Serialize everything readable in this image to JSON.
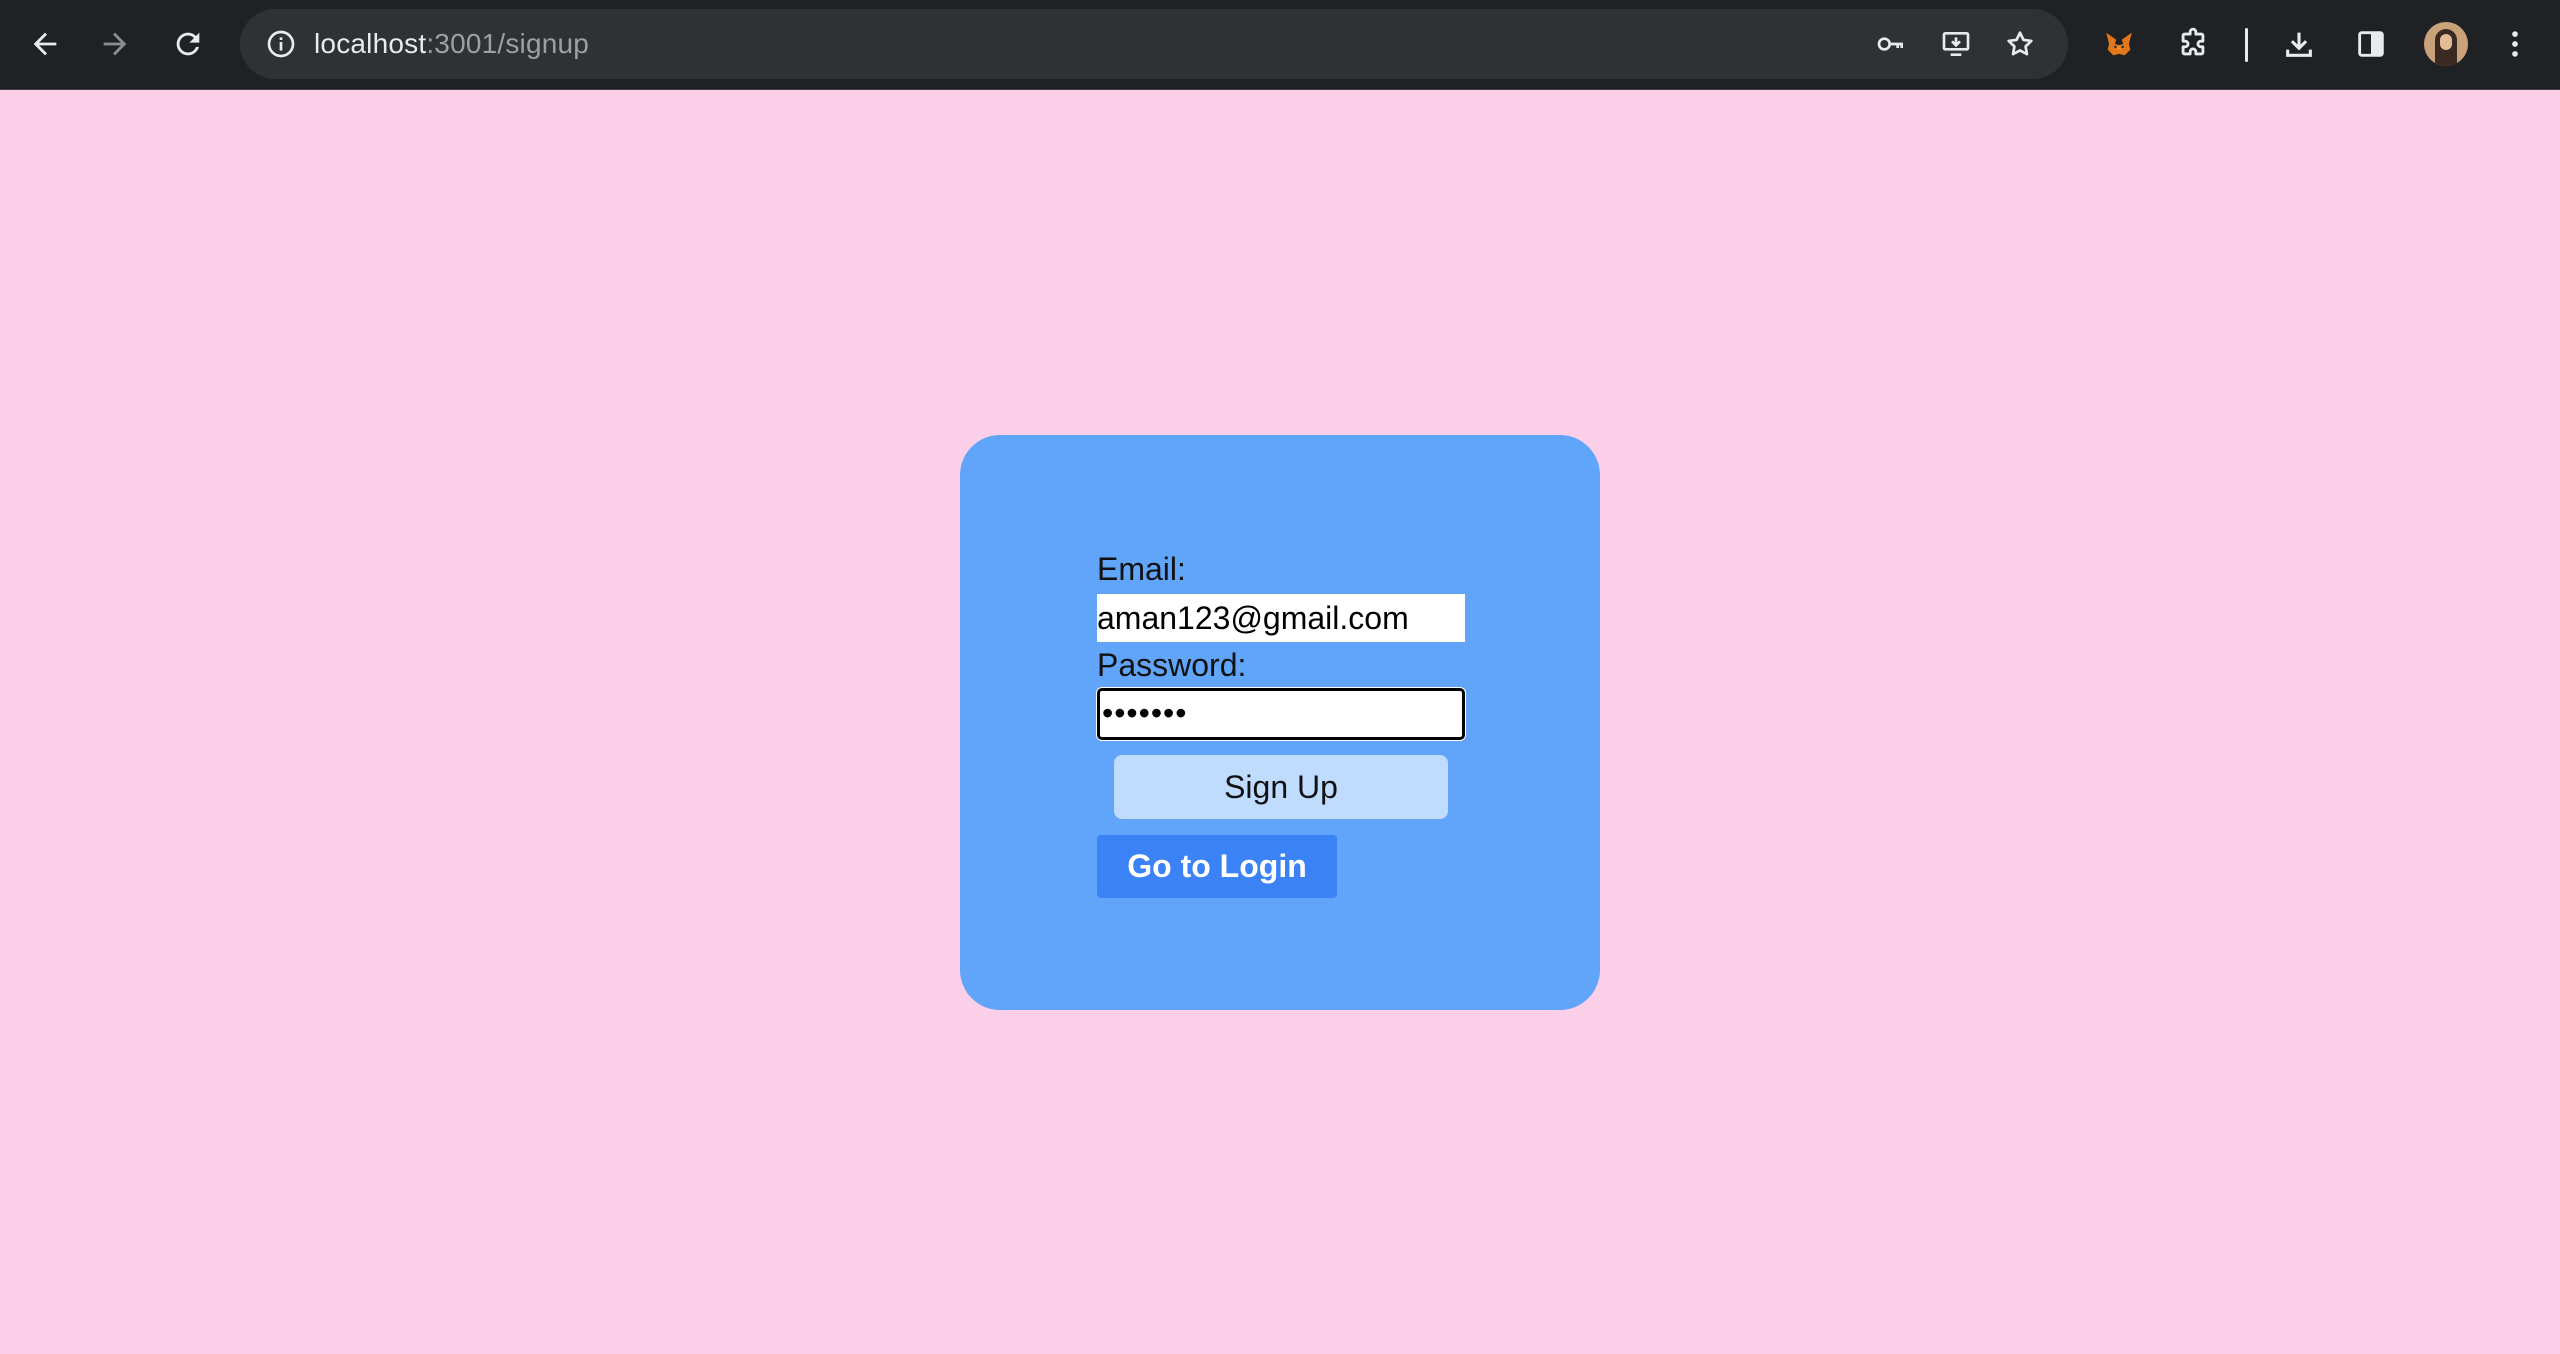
{
  "browser": {
    "url_host": "localhost",
    "url_path": ":3001/signup",
    "icons": [
      "back-arrow-icon",
      "forward-arrow-icon",
      "reload-icon",
      "site-info-icon",
      "password-key-icon",
      "install-app-icon",
      "bookmark-star-icon",
      "metamask-fox-icon",
      "extensions-puzzle-icon",
      "downloads-icon",
      "side-panel-icon",
      "profile-avatar",
      "more-menu-icon"
    ],
    "colors": {
      "toolbar": "#202124",
      "omnibox": "#303134"
    }
  },
  "signup_form": {
    "email_label": "Email:",
    "email_value": "aman123@gmail.com",
    "password_label": "Password:",
    "password_value": "•••••••",
    "signup_button": "Sign Up",
    "login_button": "Go to Login"
  },
  "colors": {
    "page_background": "#fbcfe8",
    "card_background": "#60a5fa",
    "signup_button": "#bfdbfe",
    "login_button": "#3b82f6"
  }
}
